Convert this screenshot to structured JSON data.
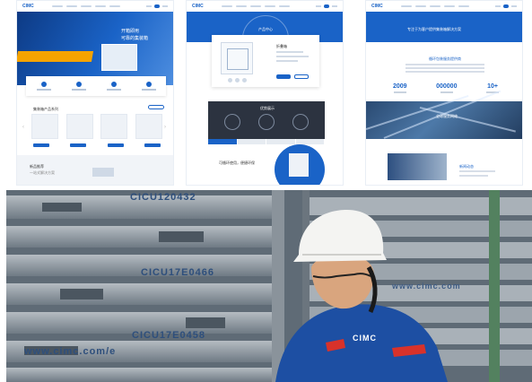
{
  "screen1": {
    "logo": "CIMC",
    "hero_line1": "开箱即用",
    "hero_line2": "可靠的集装箱",
    "products_title": "集装箱产品系列",
    "footer_line1": "新品推荐",
    "footer_line2": "一站式解决方案"
  },
  "screen2": {
    "logo": "CIMC",
    "hero_title": "产品中心",
    "card_name": "折叠箱",
    "dark_title": "优势展示",
    "low_line1": "可循环使用，便捷环保",
    "low_line2": "",
    "low_line3": ""
  },
  "screen3": {
    "logo": "CIMC",
    "hero_title": "专注于为客户提供集装箱解决方案",
    "block_heading": "循环包装服务提供商",
    "stats": [
      {
        "number": "2009"
      },
      {
        "number": "000000"
      },
      {
        "number": "10+"
      }
    ],
    "road_text": "全球服务网络",
    "bottom_title": "新闻动态"
  },
  "photo": {
    "watermarks": [
      "CICU120432",
      "CICU17E0466",
      "CICU17E0458",
      "www.cimc.com/e",
      "www.cimc.com"
    ],
    "uniform_badge": "CIMC"
  },
  "colors": {
    "brand_blue": "#1a63c7",
    "accent_orange": "#f5a300",
    "dark_panel": "#2c3340",
    "helmet": "#f4f4f2",
    "uniform": "#1d4fa3",
    "stripe_red": "#d8322a"
  }
}
